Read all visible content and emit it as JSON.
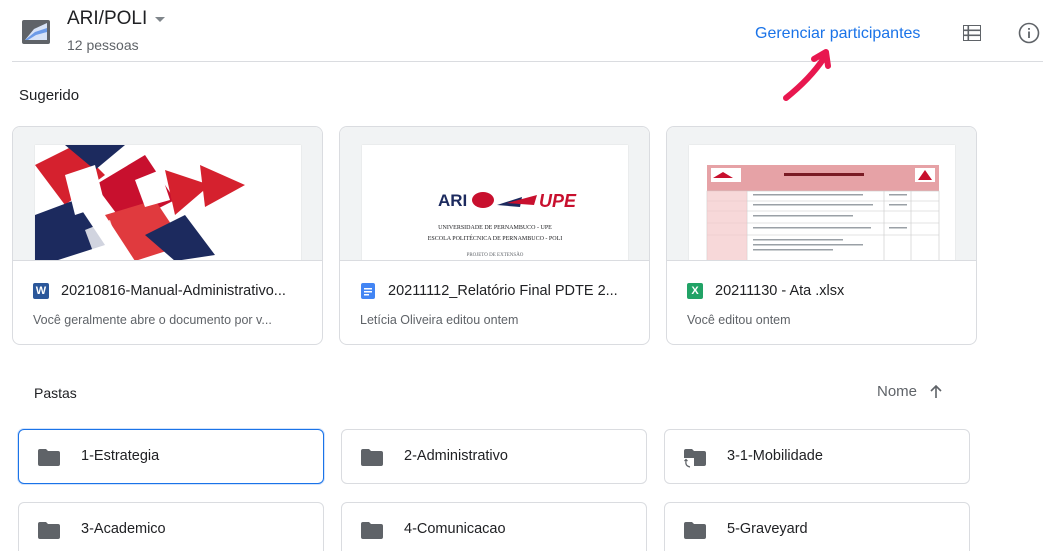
{
  "header": {
    "drive_name": "ARI/POLI",
    "members": "12 pessoas",
    "manage_link": "Gerenciar participantes",
    "icons": [
      "shared-drive-icon",
      "dropdown-caret-icon",
      "list-view-icon",
      "info-icon"
    ]
  },
  "suggested": {
    "label": "Sugerido",
    "files": [
      {
        "name": "20210816-Manual-Administrativo...",
        "meta": "Você geralmente abre o documento por v...",
        "type_badge": "W",
        "type_icon": "word-doc-icon",
        "type_color": "#2b579a"
      },
      {
        "name": "20211112_Relatório Final PDTE 2...",
        "meta": "Letícia Oliveira editou ontem",
        "type_badge": "",
        "type_icon": "google-docs-icon",
        "type_color": "#4285f4",
        "thumb_text": {
          "logo": "ARI",
          "logo2": "UPE",
          "line1": "UNIVERSIDADE DE PERNAMBUCO - UPE",
          "line2": "ESCOLA POLITÉCNICA DE PERNAMBUCO - POLI",
          "line3": "PROJETO DE EXTENSÃO"
        }
      },
      {
        "name": "20211130 - Ata .xlsx",
        "meta": "Você editou ontem",
        "type_badge": "X",
        "type_icon": "excel-sheet-icon",
        "type_color": "#21a366"
      }
    ]
  },
  "folders": {
    "label": "Pastas",
    "sort_label": "Nome",
    "sort_icon": "arrow-up-icon",
    "items": [
      {
        "name": "1-Estrategia",
        "selected": true,
        "shortcut": false
      },
      {
        "name": "2-Administrativo",
        "selected": false,
        "shortcut": false
      },
      {
        "name": "3-1-Mobilidade",
        "selected": false,
        "shortcut": true
      },
      {
        "name": "3-Academico",
        "selected": false,
        "shortcut": false
      },
      {
        "name": "4-Comunicacao",
        "selected": false,
        "shortcut": false
      },
      {
        "name": "5-Graveyard",
        "selected": false,
        "shortcut": false
      }
    ]
  },
  "colors": {
    "accent": "#1a73e8",
    "annotation": "#e8174f",
    "folder": "#5f6368"
  }
}
